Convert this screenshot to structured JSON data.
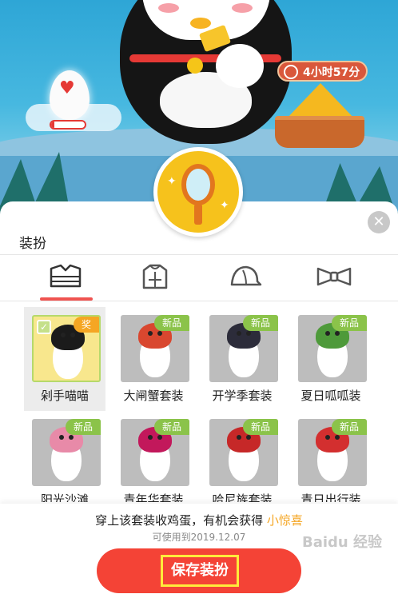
{
  "scene": {
    "egg_progress_label": "10%",
    "egg_progress_value": 0.1,
    "timer_label": "4小时57分"
  },
  "panel": {
    "title": "装扮",
    "close_icon": "close-icon",
    "tabs": [
      {
        "icon": "outfit-icon",
        "active": true
      },
      {
        "icon": "top-icon",
        "active": false
      },
      {
        "icon": "hat-icon",
        "active": false
      },
      {
        "icon": "bowtie-icon",
        "active": false
      }
    ]
  },
  "items": [
    {
      "label": "剁手喵喵",
      "badge": "奖",
      "badge_type": "award",
      "selected": true,
      "color": "#1b1b1b"
    },
    {
      "label": "大闸蟹套装",
      "badge": "新品",
      "badge_type": "new",
      "selected": false,
      "color": "#d9472f"
    },
    {
      "label": "开学季套装",
      "badge": "新品",
      "badge_type": "new",
      "selected": false,
      "color": "#2c2c3a"
    },
    {
      "label": "夏日呱呱装",
      "badge": "新品",
      "badge_type": "new",
      "selected": false,
      "color": "#4e9a3a"
    },
    {
      "label": "阳光沙滩",
      "badge": "新品",
      "badge_type": "new",
      "selected": false,
      "color": "#e88aa8"
    },
    {
      "label": "青年华套装",
      "badge": "新品",
      "badge_type": "new",
      "selected": false,
      "color": "#c2185b"
    },
    {
      "label": "哈尼族套装",
      "badge": "新品",
      "badge_type": "new",
      "selected": false,
      "color": "#c62828"
    },
    {
      "label": "青日出行装",
      "badge": "新品",
      "badge_type": "new",
      "selected": false,
      "color": "#d32f2f"
    }
  ],
  "bottom": {
    "info_prefix": "穿上该套装收鸡蛋，有机会获得 ",
    "info_highlight": "小惊喜",
    "valid_until": "可使用到2019.12.07",
    "save_label": "保存装扮",
    "watermark": "Baidu 经验"
  },
  "colors": {
    "accent": "#f44336",
    "new_badge": "#8bc34a",
    "award_badge": "#f5a623",
    "highlight": "#f5a623"
  }
}
